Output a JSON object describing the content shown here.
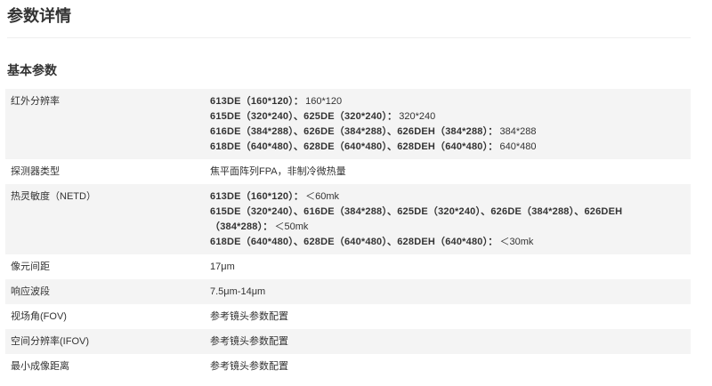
{
  "page": {
    "title": "参数详情",
    "section_title": "基本参数"
  },
  "specs": [
    {
      "label": "红外分辨率",
      "lines": [
        {
          "model": "613DE（160*120）：",
          "value": "160*120"
        },
        {
          "model": "615DE（320*240）、625DE（320*240）：",
          "value": "320*240"
        },
        {
          "model": "616DE（384*288）、626DE（384*288）、626DEH（384*288）：",
          "value": "384*288"
        },
        {
          "model": "618DE（640*480）、628DE（640*480）、628DEH（640*480）：",
          "value": "640*480"
        }
      ]
    },
    {
      "label": "探测器类型",
      "text": "焦平面阵列FPA，非制冷微热量"
    },
    {
      "label": "热灵敏度（NETD）",
      "lines": [
        {
          "model": "613DE（160*120）：",
          "value": "＜60mk"
        },
        {
          "model": "615DE（320*240）、616DE（384*288）、625DE（320*240）、626DE（384*288）、626DEH（384*288）：",
          "value": "＜50mk"
        },
        {
          "model": "618DE（640*480）、628DE（640*480）、628DEH（640*480）：",
          "value": "＜30mk"
        }
      ]
    },
    {
      "label": "像元间距",
      "text": "17μm"
    },
    {
      "label": "响应波段",
      "text": "7.5μm-14μm"
    },
    {
      "label": "视场角(FOV)",
      "text": "参考镜头参数配置"
    },
    {
      "label": "空间分辨率(IFOV)",
      "text": "参考镜头参数配置"
    },
    {
      "label": "最小成像距离",
      "text": "参考镜头参数配置"
    }
  ]
}
